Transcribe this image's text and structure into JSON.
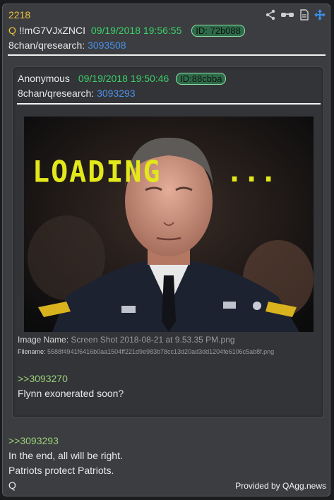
{
  "post": {
    "number": "2218",
    "author_icon": "Q",
    "tripcode": "!!mG7VJxZNCI",
    "date": "09/19/2018 19:56:55",
    "id_label": "ID: 72b088",
    "board": "8chan/qresearch:",
    "post_link": "3093508"
  },
  "quoted": {
    "author": "Anonymous",
    "date": "09/19/2018 19:50:46",
    "id_label": "ID:88cbba",
    "board": "8chan/qresearch:",
    "post_link": "3093293",
    "image": {
      "overlay_text": "LOADING",
      "overlay_dots": "...",
      "name_label": "Image Name:",
      "name_value": "Screen Shot 2018-08-21 at 9.53.35 PM.png",
      "filename_label": "Filename:",
      "filename_value": "5588f4941f6416b0aa1504ff221d9e983b78cc13d20ad3dd1204fe6106c5ab8f.png"
    },
    "reply_ref": ">>3093270",
    "text": "Flynn exonerated soon?"
  },
  "body": {
    "reply_ref": ">>3093293",
    "lines": [
      "In the end, all will be right.",
      "Patriots protect Patriots.",
      "Q"
    ]
  },
  "footer": {
    "provided_by": "Provided by QAgg.news"
  },
  "icons": [
    "share-icon",
    "glasses-icon",
    "document-icon",
    "move-icon"
  ],
  "colors": {
    "accent_yellow": "#f0c33c",
    "date_green": "#3ad26a",
    "link_blue": "#4a8ee8",
    "greentext": "#9bd07a"
  }
}
